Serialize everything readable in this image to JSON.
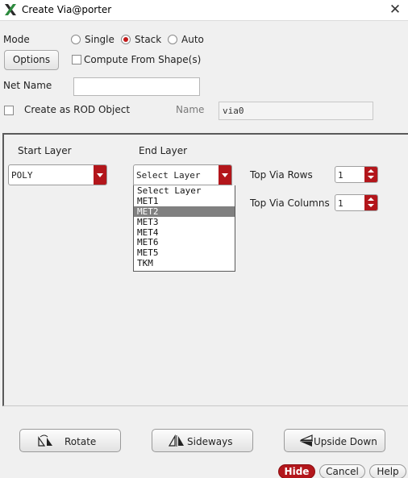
{
  "window": {
    "title": "Create Via@porter",
    "app_icon": "x-logo-icon",
    "close_icon": "close-icon",
    "close_glyph": "✕"
  },
  "mode": {
    "label": "Mode",
    "options": [
      {
        "label": "Single",
        "selected": false
      },
      {
        "label": "Stack",
        "selected": true
      },
      {
        "label": "Auto",
        "selected": false
      }
    ]
  },
  "options_button": "Options",
  "compute_from_shapes": {
    "label": "Compute From Shape(s)",
    "checked": false
  },
  "net_name": {
    "label": "Net Name",
    "value": ""
  },
  "rod": {
    "label": "Create as ROD Object",
    "checked": false
  },
  "name_field": {
    "label": "Name",
    "value": "via0"
  },
  "layers": {
    "start_label": "Start Layer",
    "start_value": "POLY",
    "end_label": "End Layer",
    "end_value": "Select Layer",
    "end_options": [
      "Select Layer",
      "MET1",
      "MET2",
      "MET3",
      "MET4",
      "MET6",
      "MET5",
      "TKM"
    ],
    "highlighted_option": "MET2"
  },
  "top_via_rows": {
    "label": "Top Via Rows",
    "value": "1"
  },
  "top_via_columns": {
    "label": "Top Via Columns",
    "value": "1"
  },
  "transform_buttons": {
    "rotate": "Rotate",
    "sideways": "Sideways",
    "upside_down": "Upside Down"
  },
  "footer": {
    "hide": "Hide",
    "cancel": "Cancel",
    "help": "Help"
  },
  "colors": {
    "accent": "#b3161b",
    "highlight": "#808080"
  }
}
